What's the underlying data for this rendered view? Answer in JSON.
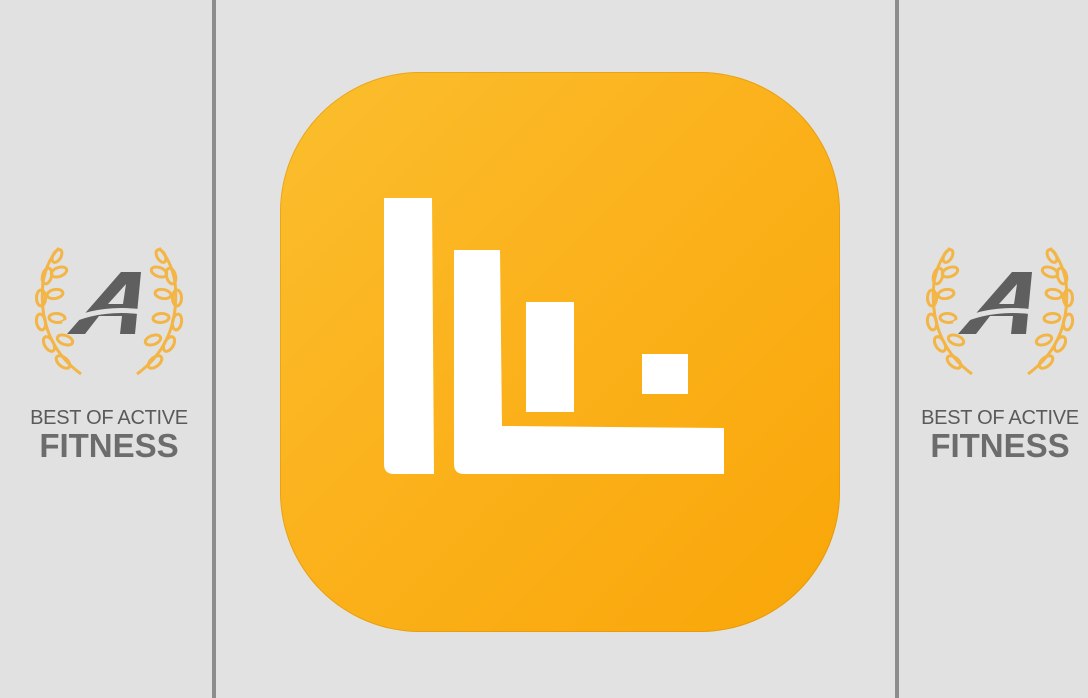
{
  "badge": {
    "line1": "BEST OF ACTIVE",
    "line2": "FITNESS",
    "logo_icon": "laurel-wreath-a-logo-icon",
    "laurel_color": "#f3b545",
    "letter_color": "#5f5f5f"
  },
  "app_icon": {
    "icon": "bar-chart-app-icon",
    "background_color": "#fbb324",
    "glyph_color": "#ffffff"
  }
}
